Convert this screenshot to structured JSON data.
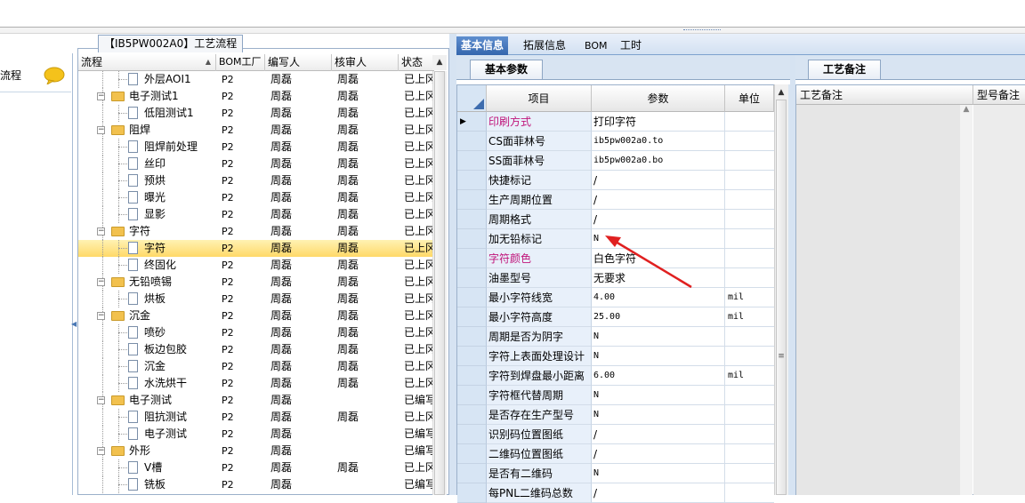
{
  "left_panel": {
    "label": "流程"
  },
  "tree": {
    "title": "【IB5PW002A0】工艺流程",
    "columns": [
      "流程",
      "BOM工厂",
      "编写人",
      "核审人",
      "状态"
    ],
    "rows": [
      {
        "label": "外层AOI1",
        "bom": "P2",
        "writer": "周磊",
        "reviewer": "周磊",
        "status": "已上冈",
        "type": "leaf",
        "level": 1
      },
      {
        "label": "电子测试1",
        "bom": "P2",
        "writer": "周磊",
        "reviewer": "周磊",
        "status": "已上冈",
        "type": "folder",
        "level": 0
      },
      {
        "label": "低阻测试1",
        "bom": "P2",
        "writer": "周磊",
        "reviewer": "周磊",
        "status": "已上冈",
        "type": "leaf",
        "level": 1
      },
      {
        "label": "阻焊",
        "bom": "P2",
        "writer": "周磊",
        "reviewer": "周磊",
        "status": "已上冈",
        "type": "folder",
        "level": 0
      },
      {
        "label": "阻焊前处理",
        "bom": "P2",
        "writer": "周磊",
        "reviewer": "周磊",
        "status": "已上冈",
        "type": "leaf",
        "level": 1
      },
      {
        "label": "丝印",
        "bom": "P2",
        "writer": "周磊",
        "reviewer": "周磊",
        "status": "已上冈",
        "type": "leaf",
        "level": 1
      },
      {
        "label": "预烘",
        "bom": "P2",
        "writer": "周磊",
        "reviewer": "周磊",
        "status": "已上冈",
        "type": "leaf",
        "level": 1
      },
      {
        "label": "曝光",
        "bom": "P2",
        "writer": "周磊",
        "reviewer": "周磊",
        "status": "已上冈",
        "type": "leaf",
        "level": 1
      },
      {
        "label": "显影",
        "bom": "P2",
        "writer": "周磊",
        "reviewer": "周磊",
        "status": "已上冈",
        "type": "leaf",
        "level": 1
      },
      {
        "label": "字符",
        "bom": "P2",
        "writer": "周磊",
        "reviewer": "周磊",
        "status": "已上冈",
        "type": "folder",
        "level": 0
      },
      {
        "label": "字符",
        "bom": "P2",
        "writer": "周磊",
        "reviewer": "周磊",
        "status": "已上冈",
        "type": "leaf",
        "level": 1,
        "selected": true
      },
      {
        "label": "终固化",
        "bom": "P2",
        "writer": "周磊",
        "reviewer": "周磊",
        "status": "已上冈",
        "type": "leaf",
        "level": 1
      },
      {
        "label": "无铅喷锡",
        "bom": "P2",
        "writer": "周磊",
        "reviewer": "周磊",
        "status": "已上冈",
        "type": "folder",
        "level": 0
      },
      {
        "label": "烘板",
        "bom": "P2",
        "writer": "周磊",
        "reviewer": "周磊",
        "status": "已上冈",
        "type": "leaf",
        "level": 1
      },
      {
        "label": "沉金",
        "bom": "P2",
        "writer": "周磊",
        "reviewer": "周磊",
        "status": "已上冈",
        "type": "folder",
        "level": 0
      },
      {
        "label": "喷砂",
        "bom": "P2",
        "writer": "周磊",
        "reviewer": "周磊",
        "status": "已上冈",
        "type": "leaf",
        "level": 1
      },
      {
        "label": "板边包胶",
        "bom": "P2",
        "writer": "周磊",
        "reviewer": "周磊",
        "status": "已上冈",
        "type": "leaf",
        "level": 1
      },
      {
        "label": "沉金",
        "bom": "P2",
        "writer": "周磊",
        "reviewer": "周磊",
        "status": "已上冈",
        "type": "leaf",
        "level": 1
      },
      {
        "label": "水洗烘干",
        "bom": "P2",
        "writer": "周磊",
        "reviewer": "周磊",
        "status": "已上冈",
        "type": "leaf",
        "level": 1
      },
      {
        "label": "电子测试",
        "bom": "P2",
        "writer": "周磊",
        "reviewer": "",
        "status": "已编写",
        "type": "folder",
        "level": 0
      },
      {
        "label": "阻抗测试",
        "bom": "P2",
        "writer": "周磊",
        "reviewer": "周磊",
        "status": "已上冈",
        "type": "leaf",
        "level": 1
      },
      {
        "label": "电子测试",
        "bom": "P2",
        "writer": "周磊",
        "reviewer": "",
        "status": "已编写",
        "type": "leaf",
        "level": 1
      },
      {
        "label": "外形",
        "bom": "P2",
        "writer": "周磊",
        "reviewer": "",
        "status": "已编写",
        "type": "folder",
        "level": 0
      },
      {
        "label": "V槽",
        "bom": "P2",
        "writer": "周磊",
        "reviewer": "周磊",
        "status": "已上冈",
        "type": "leaf",
        "level": 1
      },
      {
        "label": "铣板",
        "bom": "P2",
        "writer": "周磊",
        "reviewer": "",
        "status": "已编写",
        "type": "leaf",
        "level": 1
      }
    ]
  },
  "right_tabs": [
    "基本信息",
    "拓展信息",
    "BOM",
    "工时"
  ],
  "param_panel": {
    "subtab": "基本参数",
    "columns": [
      "项目",
      "参数",
      "单位"
    ],
    "rows": [
      {
        "name": "印刷方式",
        "value": "打印字符",
        "unit": "",
        "highlight": true,
        "current": true
      },
      {
        "name": "CS面菲林号",
        "value": "ib5pw002a0.to",
        "unit": "",
        "mono": true
      },
      {
        "name": "SS面菲林号",
        "value": "ib5pw002a0.bo",
        "unit": "",
        "mono": true
      },
      {
        "name": "快捷标记",
        "value": "/",
        "unit": ""
      },
      {
        "name": "生产周期位置",
        "value": "/",
        "unit": ""
      },
      {
        "name": "周期格式",
        "value": "/",
        "unit": ""
      },
      {
        "name": "加无铅标记",
        "value": "N",
        "unit": "",
        "mono": true
      },
      {
        "name": "字符颜色",
        "value": "白色字符",
        "unit": "",
        "highlight": true
      },
      {
        "name": "油墨型号",
        "value": "无要求",
        "unit": ""
      },
      {
        "name": "最小字符线宽",
        "value": "4.00",
        "unit": "mil",
        "mono": true
      },
      {
        "name": "最小字符高度",
        "value": "25.00",
        "unit": "mil",
        "mono": true
      },
      {
        "name": "周期是否为阴字",
        "value": "N",
        "unit": "",
        "mono": true
      },
      {
        "name": "字符上表面处理设计",
        "value": "N",
        "unit": "",
        "mono": true
      },
      {
        "name": "字符到焊盘最小距离",
        "value": "6.00",
        "unit": "mil",
        "mono": true
      },
      {
        "name": "字符框代替周期",
        "value": "N",
        "unit": "",
        "mono": true
      },
      {
        "name": "是否存在生产型号",
        "value": "N",
        "unit": "",
        "mono": true
      },
      {
        "name": "识别码位置图纸",
        "value": "/",
        "unit": ""
      },
      {
        "name": "二维码位置图纸",
        "value": "/",
        "unit": ""
      },
      {
        "name": "是否有二维码",
        "value": "N",
        "unit": "",
        "mono": true
      },
      {
        "name": "每PNL二维码总数",
        "value": "/",
        "unit": ""
      }
    ]
  },
  "note_panel": {
    "subtab": "工艺备注",
    "columns": [
      "工艺备注",
      "型号备注"
    ]
  },
  "colors": {
    "accent": "#3566ad",
    "highlight_text": "#c0147a",
    "selected_row": "#ffd968",
    "arrow": "#e02020"
  }
}
